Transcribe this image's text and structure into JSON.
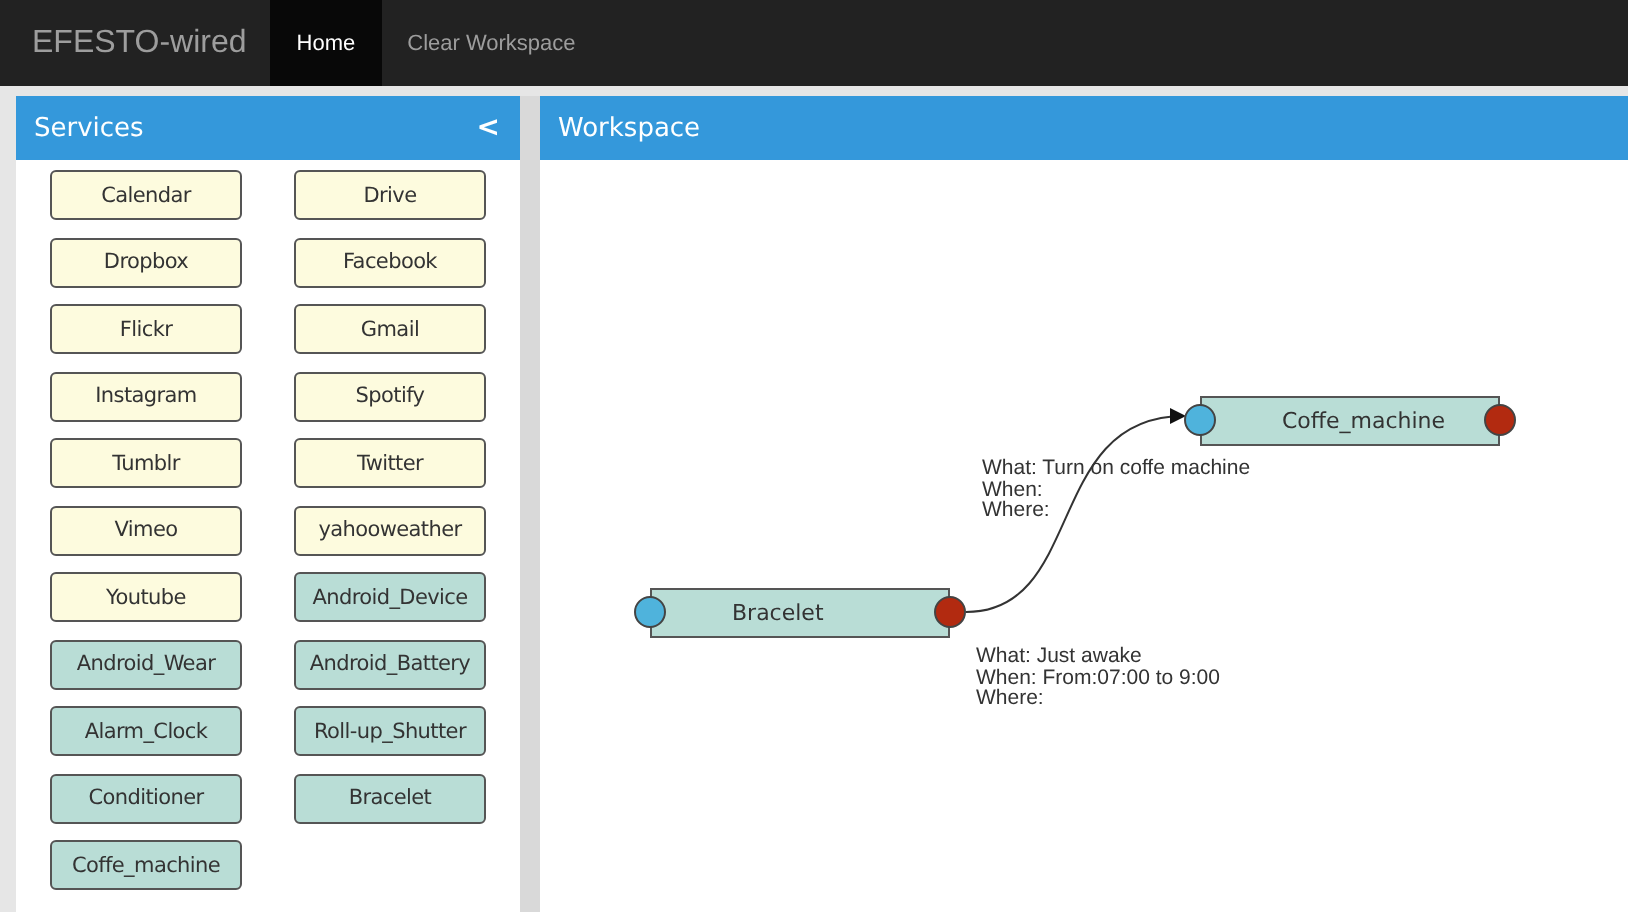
{
  "navbar": {
    "brand": "EFESTO-wired",
    "items": [
      {
        "label": "Home",
        "selected": true
      },
      {
        "label": "Clear Workspace",
        "selected": false
      }
    ]
  },
  "services": {
    "title": "Services",
    "collapse_icon": "<",
    "items": [
      {
        "label": "Calendar",
        "kind": "web"
      },
      {
        "label": "Drive",
        "kind": "web"
      },
      {
        "label": "Dropbox",
        "kind": "web"
      },
      {
        "label": "Facebook",
        "kind": "web"
      },
      {
        "label": "Flickr",
        "kind": "web"
      },
      {
        "label": "Gmail",
        "kind": "web"
      },
      {
        "label": "Instagram",
        "kind": "web"
      },
      {
        "label": "Spotify",
        "kind": "web"
      },
      {
        "label": "Tumblr",
        "kind": "web"
      },
      {
        "label": "Twitter",
        "kind": "web"
      },
      {
        "label": "Vimeo",
        "kind": "web"
      },
      {
        "label": "yahooweather",
        "kind": "web"
      },
      {
        "label": "Youtube",
        "kind": "web"
      },
      {
        "label": "Android_Device",
        "kind": "device"
      },
      {
        "label": "Android_Wear",
        "kind": "device"
      },
      {
        "label": "Android_Battery",
        "kind": "device"
      },
      {
        "label": "Alarm_Clock",
        "kind": "device"
      },
      {
        "label": "Roll-up_Shutter",
        "kind": "device"
      },
      {
        "label": "Conditioner",
        "kind": "device"
      },
      {
        "label": "Bracelet",
        "kind": "device"
      },
      {
        "label": "Coffe_machine",
        "kind": "device"
      }
    ]
  },
  "workspace": {
    "title": "Workspace",
    "nodes": [
      {
        "label": "Bracelet"
      },
      {
        "label": "Coffe_machine"
      }
    ],
    "annotations": [
      {
        "lines": [
          "What: Turn on coffe machine",
          "When:",
          "Where:"
        ]
      },
      {
        "lines": [
          "What: Just awake",
          "When: From:07:00 to 9:00",
          "Where:"
        ]
      }
    ]
  }
}
